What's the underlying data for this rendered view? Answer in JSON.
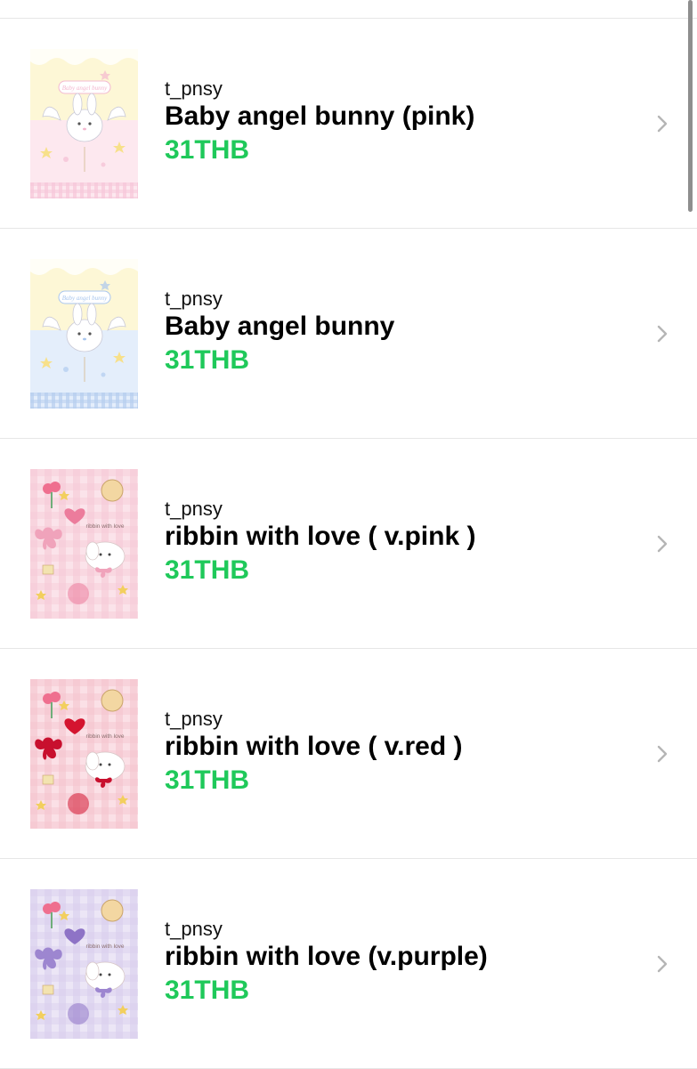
{
  "items": [
    {
      "author": "t_pnsy",
      "title": "Baby angel bunny (pink)",
      "price": "31THB",
      "thumb_text": "Baby angel bunny",
      "thumb_style": "bunny",
      "colors": {
        "top": "#fdf7d6",
        "bottom": "#fde8ef",
        "accent": "#f3b8cf",
        "check": "#f6c6d8"
      }
    },
    {
      "author": "t_pnsy",
      "title": "Baby angel bunny",
      "price": "31THB",
      "thumb_text": "Baby angel bunny",
      "thumb_style": "bunny",
      "colors": {
        "top": "#fdf7d6",
        "bottom": "#e4eefb",
        "accent": "#a9c6ee",
        "check": "#b7cdee"
      }
    },
    {
      "author": "t_pnsy",
      "title": "ribbin with love ( v.pink )",
      "price": "31THB",
      "thumb_text": "ribbin with love",
      "thumb_style": "ribbon",
      "colors": {
        "bg": "#fbe3ea",
        "grid": "#f6c9d6",
        "ribbon": "#f0a3bb",
        "heart": "#ec7c9c"
      }
    },
    {
      "author": "t_pnsy",
      "title": "ribbin with love ( v.red )",
      "price": "31THB",
      "thumb_text": "ribbin with love",
      "thumb_style": "ribbon",
      "colors": {
        "bg": "#fbe0e6",
        "grid": "#f5c4cf",
        "ribbon": "#c8102e",
        "heart": "#d4142f"
      }
    },
    {
      "author": "t_pnsy",
      "title": "ribbin with love (v.purple)",
      "price": "31THB",
      "thumb_text": "ribbin with love",
      "thumb_style": "ribbon",
      "colors": {
        "bg": "#ece6f6",
        "grid": "#d9cfee",
        "ribbon": "#9d86d0",
        "heart": "#8e73c6"
      }
    }
  ]
}
